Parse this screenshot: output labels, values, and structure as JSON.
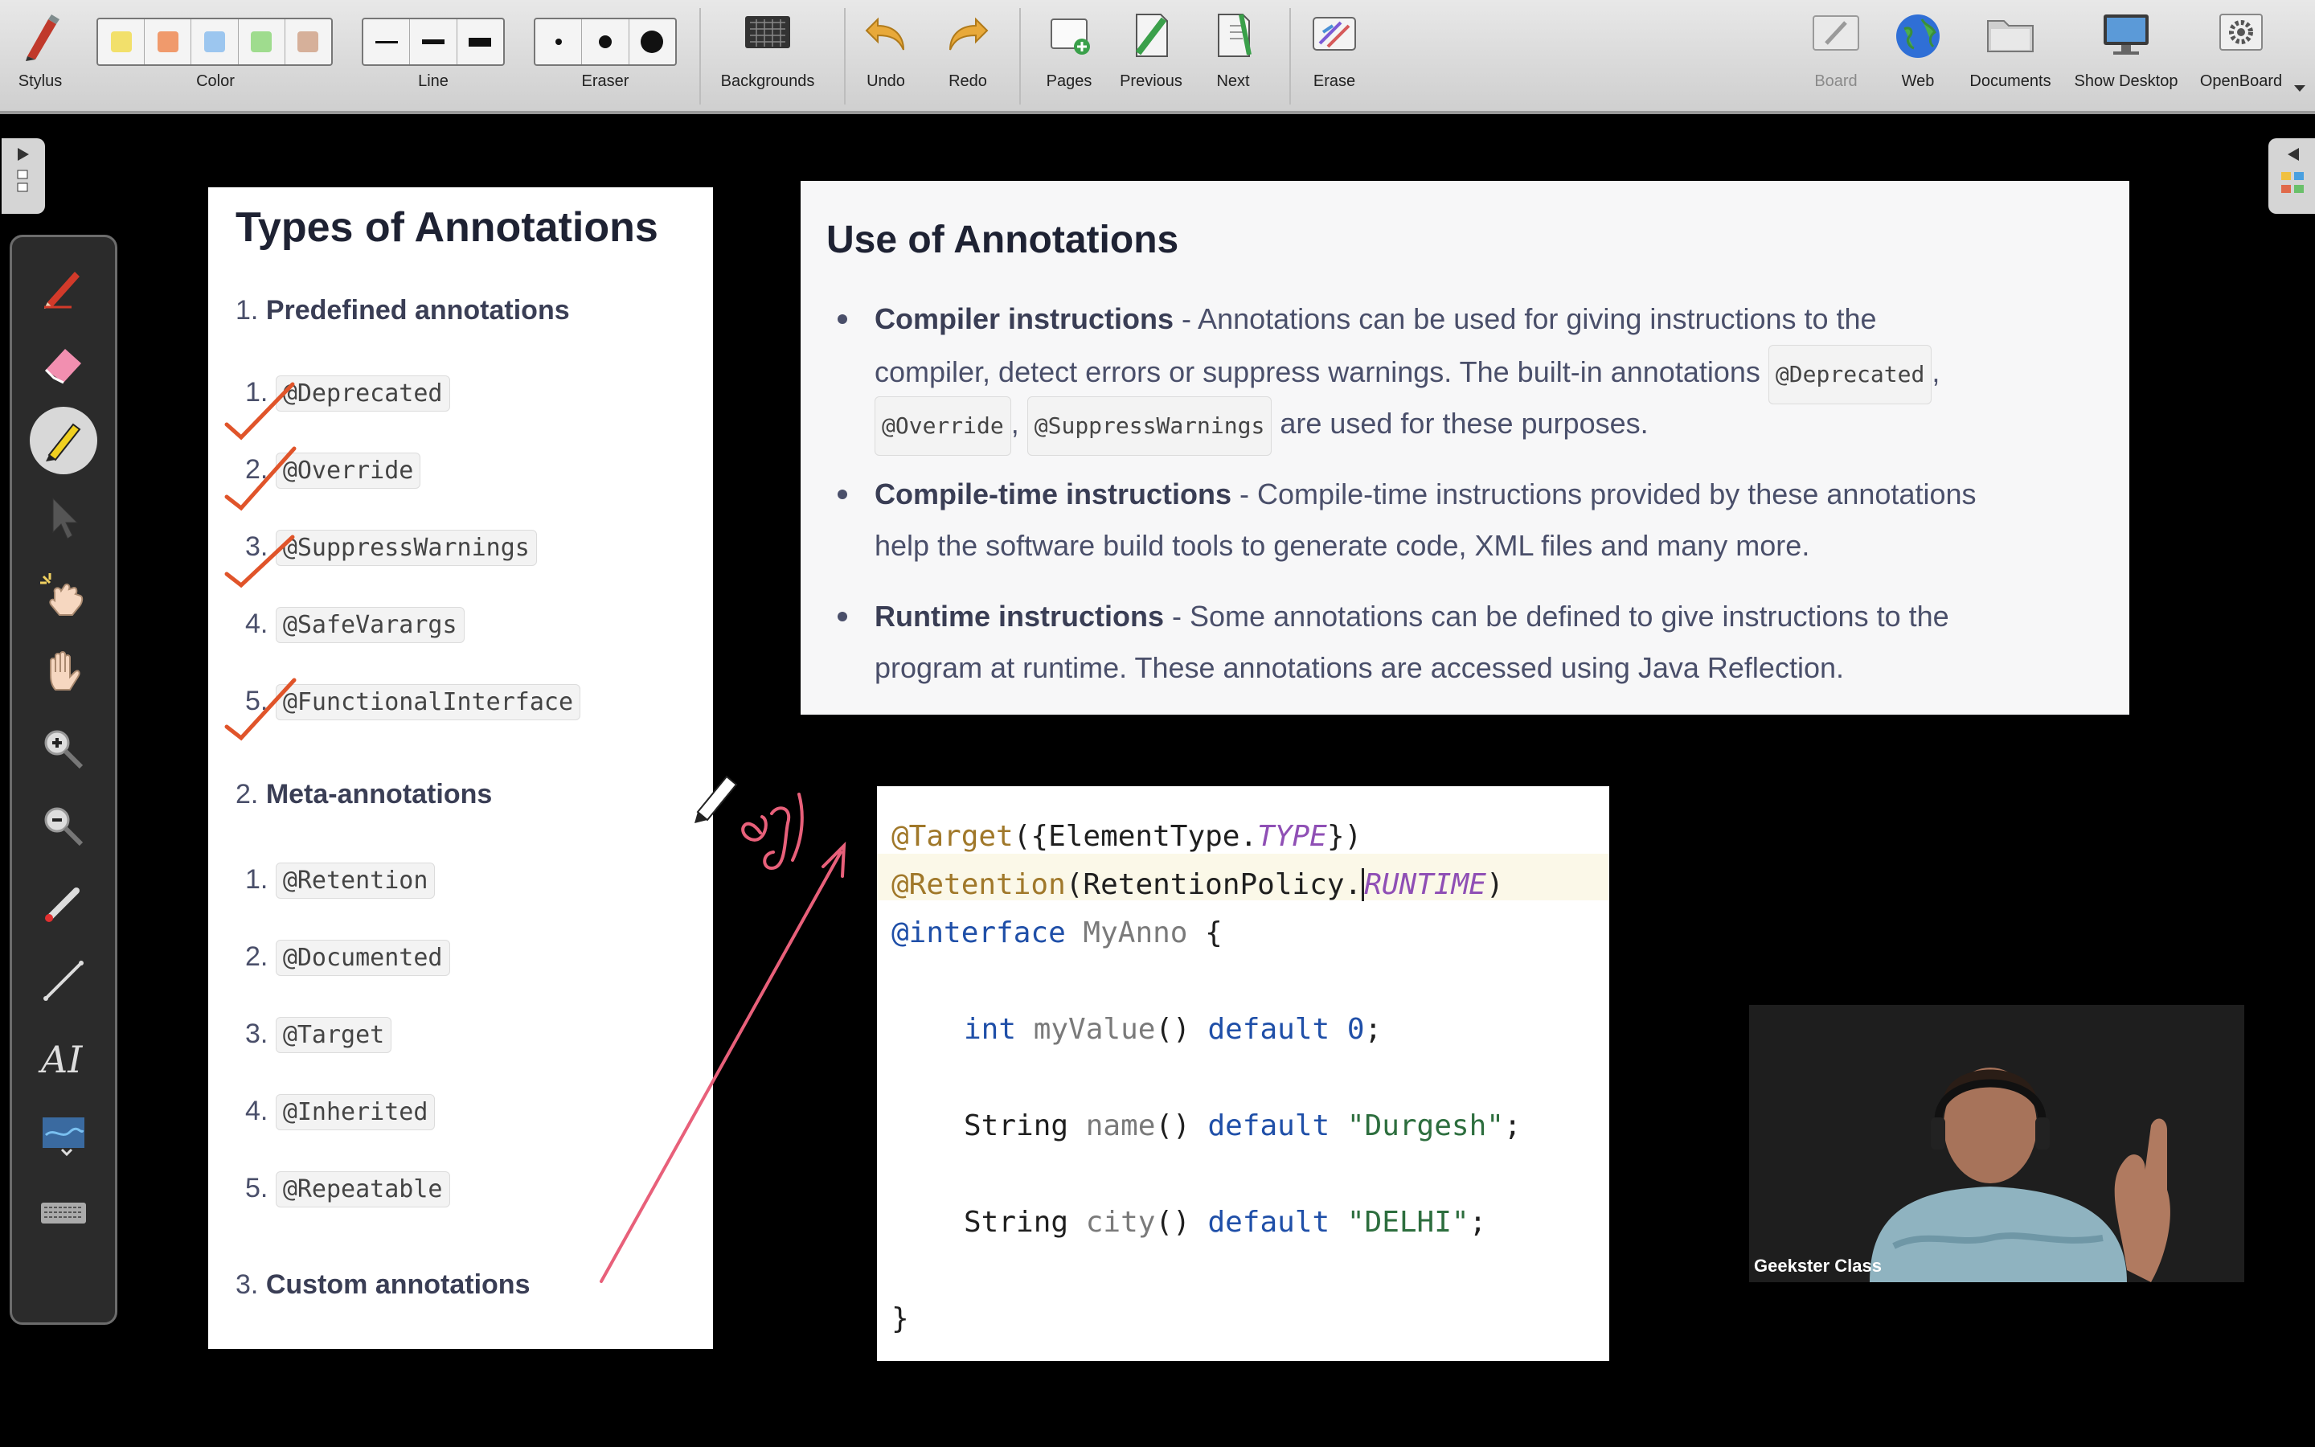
{
  "toolbar": {
    "stylus": "Stylus",
    "color": "Color",
    "line": "Line",
    "eraser": "Eraser",
    "backgrounds": "Backgrounds",
    "undo": "Undo",
    "redo": "Redo",
    "pages": "Pages",
    "previous": "Previous",
    "next": "Next",
    "erase": "Erase",
    "board": "Board",
    "web": "Web",
    "documents": "Documents",
    "show_desktop": "Show Desktop",
    "openboard": "OpenBoard",
    "colors": [
      "#f2e06b",
      "#f09a6c",
      "#9cc6ef",
      "#9fdc8e",
      "#d6b09a"
    ]
  },
  "left_card": {
    "title": "Types of Annotations",
    "sections": [
      {
        "num": "1.",
        "title": "Predefined annotations",
        "items": [
          {
            "num": "1.",
            "code": "@Deprecated"
          },
          {
            "num": "2.",
            "code": "@Override"
          },
          {
            "num": "3.",
            "code": "@SuppressWarnings"
          },
          {
            "num": "4.",
            "code": "@SafeVarargs"
          },
          {
            "num": "5.",
            "code": "@FunctionalInterface"
          }
        ]
      },
      {
        "num": "2.",
        "title": "Meta-annotations",
        "items": [
          {
            "num": "1.",
            "code": "@Retention"
          },
          {
            "num": "2.",
            "code": "@Documented"
          },
          {
            "num": "3.",
            "code": "@Target"
          },
          {
            "num": "4.",
            "code": "@Inherited"
          },
          {
            "num": "5.",
            "code": "@Repeatable"
          }
        ]
      },
      {
        "num": "3.",
        "title": "Custom annotations"
      }
    ]
  },
  "use_card": {
    "title": "Use of Annotations",
    "bullets": [
      {
        "bold": "Compiler instructions",
        "line1": " - Annotations can be used for giving instructions to the",
        "line2": "compiler, detect errors or suppress warnings. The built-in annotations",
        "chip1": "@Deprecated",
        "comma": ",",
        "chip2": "@Override",
        "comma2": ",",
        "chip3": "@SuppressWarnings",
        "tail": " are used for these purposes."
      },
      {
        "bold": "Compile-time instructions",
        "line1": " - Compile-time instructions provided by these annotations",
        "line2": "help the software build tools to generate code, XML files and many more."
      },
      {
        "bold": "Runtime instructions",
        "line1": " - Some annotations can be defined to give instructions to the",
        "line2": "program at runtime. These annotations are accessed using Java Reflection."
      }
    ]
  },
  "code": {
    "l1a": "@Target",
    "l1b": "({ElementType.",
    "l1c": "TYPE",
    "l1d": "})",
    "l2a": "@Retention",
    "l2b": "(RetentionPolicy.",
    "l2c": "RUNTIME",
    "l2d": ")",
    "l3a": "@interface",
    "l3b": " MyAnno",
    "l3c": " {",
    "l4a": "int",
    "l4b": " myValue",
    "l4c": "() ",
    "l4d": "default",
    "l4e": " 0",
    "l4f": ";",
    "l5a": "String",
    "l5b": " name",
    "l5c": "() ",
    "l5d": "default",
    "l5e": " \"Durgesh\"",
    "l5f": ";",
    "l6a": "String",
    "l6b": " city",
    "l6c": "() ",
    "l6d": "default",
    "l6e": " \"DELHI\"",
    "l6f": ";",
    "l7": "}"
  },
  "handwriting": {
    "eg": "eg"
  },
  "webcam": {
    "name": "Geekster Class"
  }
}
